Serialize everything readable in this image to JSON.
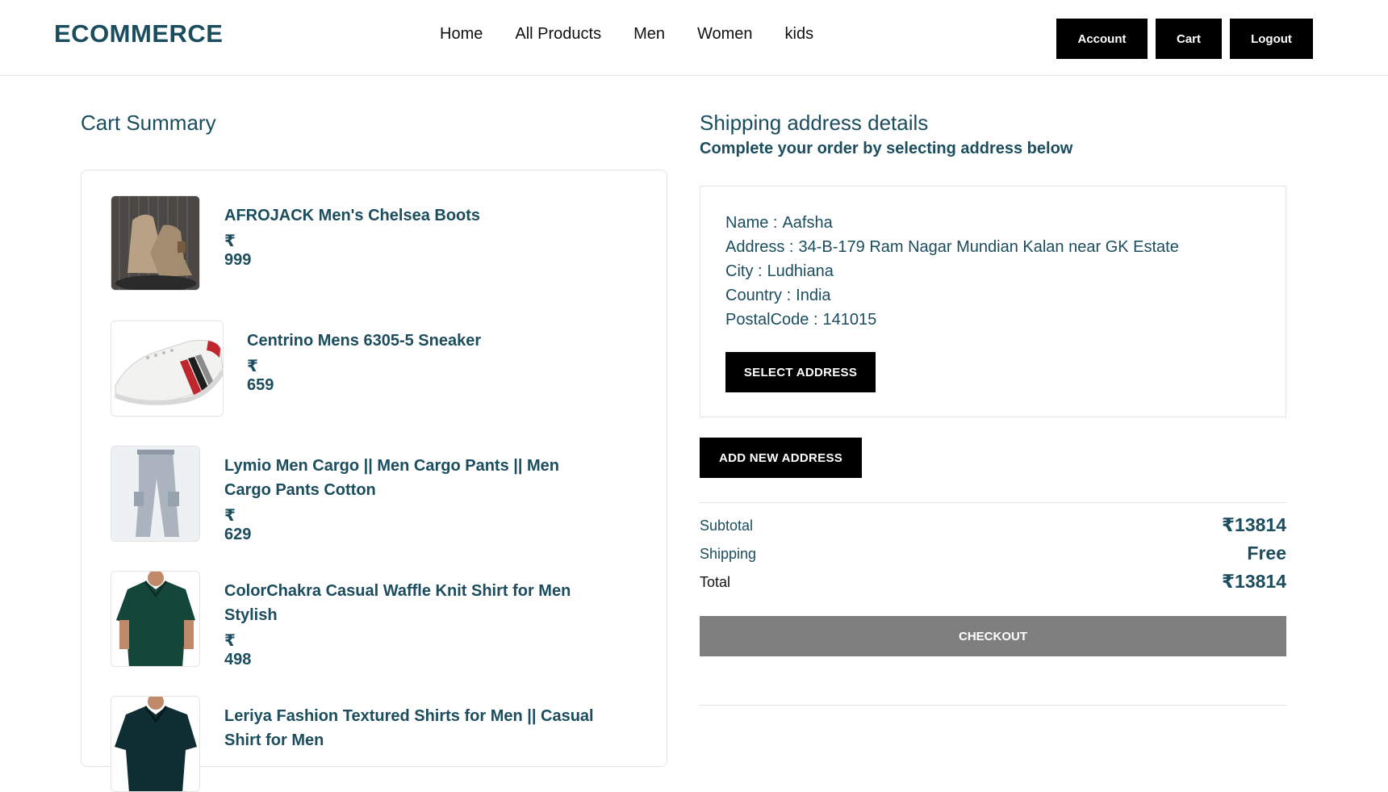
{
  "header": {
    "brand": "ECOMMERCE",
    "nav": [
      "Home",
      "All Products",
      "Men",
      "Women",
      "kids"
    ],
    "buttons": {
      "account": "Account",
      "cart": "Cart",
      "logout": "Logout"
    }
  },
  "cart": {
    "title": "Cart Summary",
    "items": [
      {
        "name": "AFROJACK Men's Chelsea Boots",
        "price": "₹ 999",
        "image": "chelsea-boots-image"
      },
      {
        "name": "Centrino Mens 6305-5 Sneaker",
        "price": "₹ 659",
        "image": "sneaker-image"
      },
      {
        "name": "Lymio Men Cargo || Men Cargo Pants || Men Cargo Pants Cotton",
        "price": "₹ 629",
        "image": "cargo-pants-image"
      },
      {
        "name": "ColorChakra Casual Waffle Knit Shirt for Men Stylish",
        "price": "₹ 498",
        "image": "green-shirt-image"
      },
      {
        "name": "Leriya Fashion Textured Shirts for Men || Casual Shirt for Men",
        "price": "",
        "image": "dark-shirt-image"
      }
    ]
  },
  "shipping": {
    "title": "Shipping address details",
    "subtitle": "Complete your order by selecting address below",
    "address": {
      "name_label": "Name :",
      "name": "Aafsha",
      "address_label": "Address :",
      "address": "34-B-179 Ram Nagar Mundian Kalan near GK Estate",
      "city_label": "City :",
      "city": "Ludhiana",
      "country_label": "Country :",
      "country": "India",
      "postal_label": "PostalCode :",
      "postal": "141015"
    },
    "select_label": "SELECT ADDRESS",
    "add_label": "ADD NEW ADDRESS"
  },
  "summary": {
    "subtotal_label": "Subtotal",
    "subtotal": "₹13814",
    "shipping_label": "Shipping",
    "shipping": "Free",
    "total_label": "Total",
    "total": "₹13814",
    "checkout_label": "CHECKOUT"
  },
  "colors": {
    "primary_text": "#1b4d5e",
    "button_bg": "#000000",
    "checkout_bg": "#7f7f7f"
  }
}
